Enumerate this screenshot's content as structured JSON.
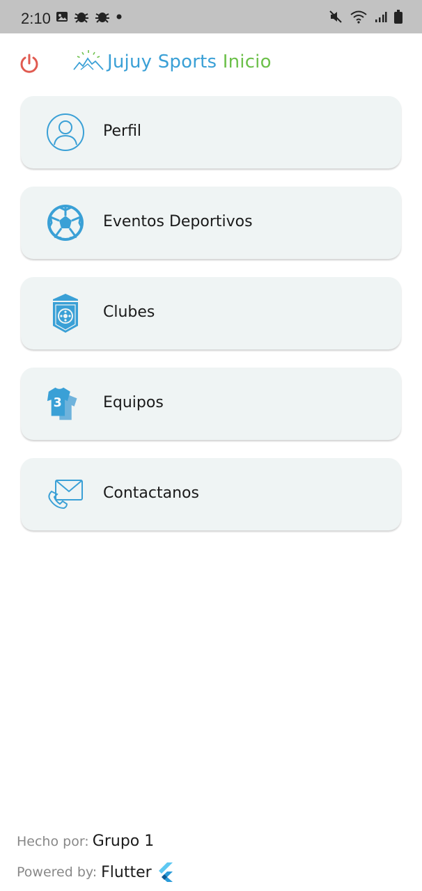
{
  "status_bar": {
    "time": "2:10",
    "left_icons": [
      "image-icon",
      "bug-icon",
      "bug-icon",
      "dot-icon"
    ],
    "right_icons": [
      "mute-icon",
      "wifi-icon",
      "signal-icon",
      "battery-icon"
    ]
  },
  "header": {
    "brand_part1": "Jujuy Sports",
    "brand_part2": "Inicio",
    "brand_color": "#3aa0d6",
    "accent_color": "#6cc04a",
    "power_color": "#e05a50"
  },
  "menu": {
    "items": [
      {
        "label": "Perfil",
        "icon": "user-icon"
      },
      {
        "label": "Eventos Deportivos",
        "icon": "soccer-ball-icon"
      },
      {
        "label": "Clubes",
        "icon": "club-pennant-icon"
      },
      {
        "label": "Equipos",
        "icon": "jersey-icon"
      },
      {
        "label": "Contactanos",
        "icon": "contact-mail-icon"
      }
    ]
  },
  "footer": {
    "made_by_label": "Hecho por:",
    "made_by_value": "Grupo 1",
    "powered_label": "Powered by:",
    "powered_value": "Flutter",
    "powered_icon": "flutter-icon"
  }
}
